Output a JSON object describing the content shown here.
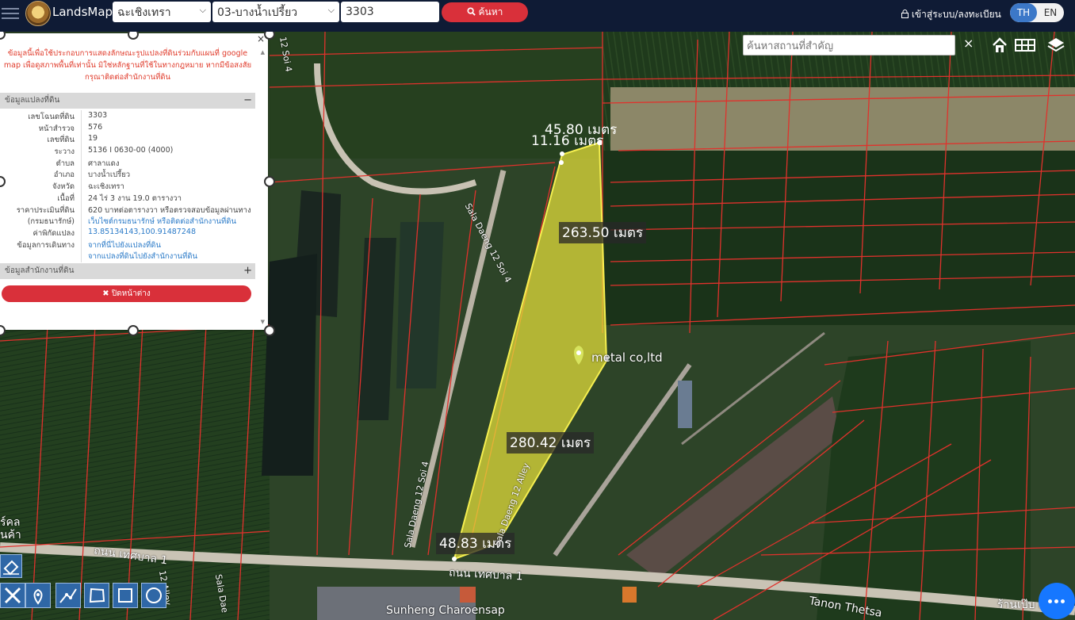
{
  "header": {
    "brand": "LandsMaps",
    "province": "ฉะเชิงเทรา",
    "district": "03-บางน้ำเปรี้ยว",
    "parcel_no": "3303",
    "search_label": "ค้นหา",
    "login_label": "เข้าสู่ระบบ/ลงทะเบียน",
    "lang_th": "TH",
    "lang_en": "EN"
  },
  "panel": {
    "close": "×",
    "disclaimer": "ข้อมูลนี้เพื่อใช้ประกอบการแสดงลักษณะรูปแปลงที่ดินร่วมกับแผนที่ google map เพื่อดูสภาพพื้นที่เท่านั้น มิใช่หลักฐานที่ใช้ในทางกฎหมาย หากมีข้อสงสัยกรุณาติดต่อสำนักงานที่ดิน",
    "parcel_section": "ข้อมูลแปลงที่ดิน",
    "parcel_toggle": "−",
    "office_section": "ข้อมูลสำนักงานที่ดิน",
    "office_toggle": "+",
    "rows": [
      {
        "k": "เลขโฉนดที่ดิน",
        "v": "3303"
      },
      {
        "k": "หน้าสำรวจ",
        "v": "576"
      },
      {
        "k": "เลขที่ดิน",
        "v": "19"
      },
      {
        "k": "ระวาง",
        "v": "5136 I 0630-00 (4000)"
      },
      {
        "k": "ตำบล",
        "v": "ศาลาแดง"
      },
      {
        "k": "อำเภอ",
        "v": "บางน้ำเปรี้ยว"
      },
      {
        "k": "จังหวัด",
        "v": "ฉะเชิงเทรา"
      },
      {
        "k": "เนื้อที่",
        "v": "24 ไร่ 3 งาน 19.0 ตารางวา"
      },
      {
        "k": "ราคาประเมินที่ดิน",
        "v": "620 บาทต่อตารางวา หรือตรวจสอบข้อมูลผ่านทาง"
      },
      {
        "k": "(กรมธนารักษ์)",
        "v": "เว็บไซต์กรมธนารักษ์ หรือติดต่อสำนักงานที่ดิน"
      },
      {
        "k": "ค่าพิกัดแปลง",
        "v": "13.85134143,100.91487248"
      },
      {
        "k": "ข้อมูลการเดินทาง",
        "v": "จากที่นี่ไปยังแปลงที่ดิน"
      },
      {
        "k": "",
        "v": "จากแปลงที่ดินไปยังสำนักงานที่ดิน"
      }
    ],
    "close_window": "✖ ปิดหน้าต่าง"
  },
  "map": {
    "search_placeholder": "ค้นหาสถานที่สำคัญ",
    "clear": "×",
    "measurements": [
      "45.80 เมตร",
      "11.16 เมตร",
      "263.50 เมตร",
      "280.42 เมตร",
      "48.83 เมตร"
    ],
    "labels": [
      "metal co,ltd",
      "Sala Daeng 12 Soi 4",
      "Sala Daeng 12 Soi 4",
      "Sala Daeng 12 Alley",
      "ถนน เทศบาล 1",
      "ถนน เทศบาล 1",
      "Sunheng Charoensap",
      "Tanon Thetsa",
      "ร้านเป๊บ เพ",
      "12 Soi 4",
      "12 Alley",
      "Sala Dae",
      "ร์คล",
      "นค้า"
    ],
    "polygon_color": "#e8e03a",
    "boundary_color": "#e0322c"
  },
  "icons": [
    "menu-icon",
    "search-icon",
    "lock-icon",
    "home-icon",
    "grid-icon",
    "layers-icon",
    "eraser-icon",
    "ruler-icon",
    "pin-icon",
    "line-icon",
    "polygon-icon",
    "rectangle-icon",
    "circle-icon",
    "chat-icon"
  ]
}
